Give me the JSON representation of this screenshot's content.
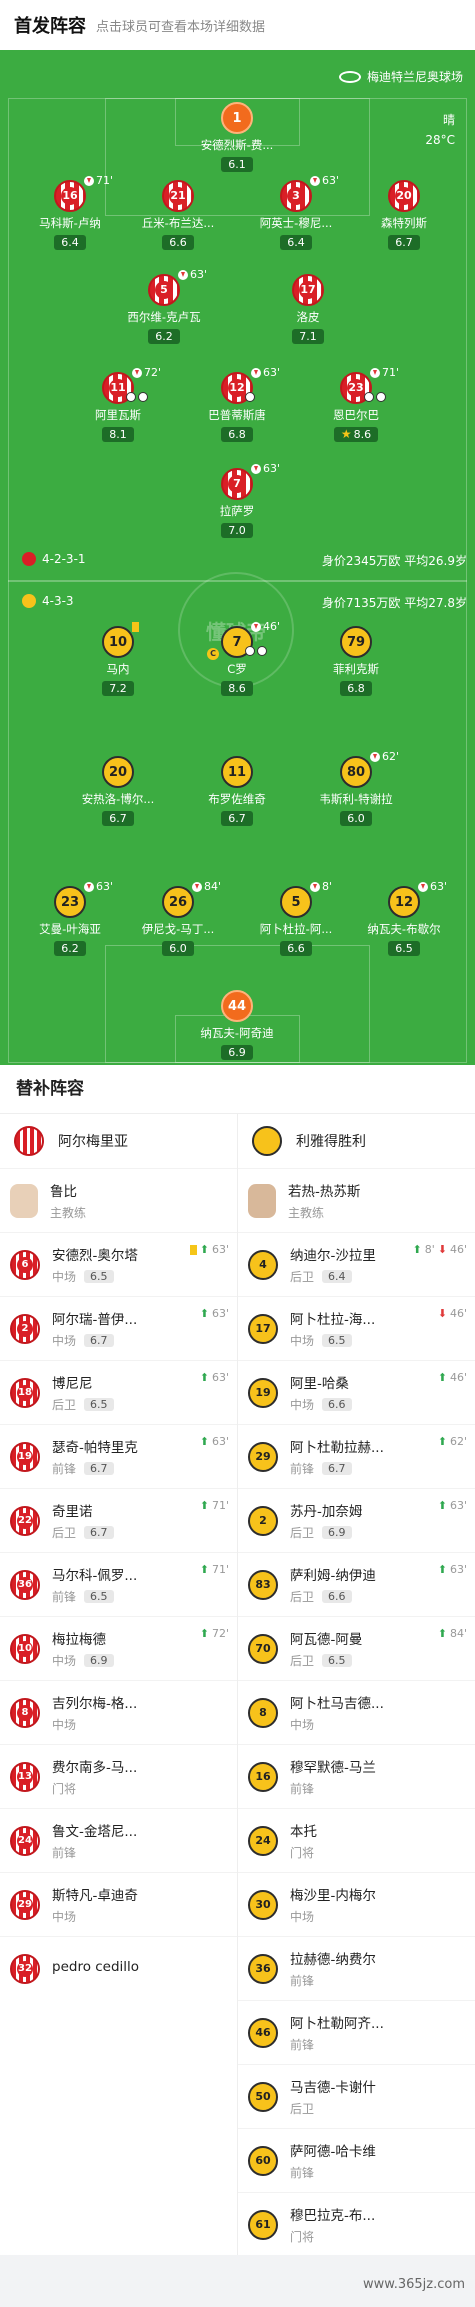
{
  "header": {
    "title": "首发阵容",
    "subtitle": "点击球员可查看本场详细数据"
  },
  "venue": "梅迪特兰尼奥球场",
  "weather": {
    "condition": "晴",
    "temp": "28°C"
  },
  "watermark": "懂球帝",
  "home_team": {
    "formation": "4-2-3-1",
    "value": "身价2345万欧",
    "age": "平均26.9岁"
  },
  "away_team": {
    "formation": "4-3-3",
    "value": "身价7135万欧",
    "age": "平均27.8岁"
  },
  "home_players": [
    {
      "num": "1",
      "name": "安德烈斯-费...",
      "rating": "6.1"
    },
    {
      "num": "16",
      "name": "马科斯-卢纳",
      "rating": "6.4",
      "sub": "71'"
    },
    {
      "num": "21",
      "name": "丘米-布兰达...",
      "rating": "6.6"
    },
    {
      "num": "3",
      "name": "阿英士-穆尼...",
      "rating": "6.4",
      "sub": "63'"
    },
    {
      "num": "20",
      "name": "森特列斯",
      "rating": "6.7"
    },
    {
      "num": "5",
      "name": "西尔维-克卢瓦",
      "rating": "6.2",
      "sub": "63'"
    },
    {
      "num": "17",
      "name": "洛皮",
      "rating": "7.1"
    },
    {
      "num": "11",
      "name": "阿里瓦斯",
      "rating": "8.1",
      "sub": "72'"
    },
    {
      "num": "12",
      "name": "巴普蒂斯唐",
      "rating": "6.8",
      "sub": "63'"
    },
    {
      "num": "23",
      "name": "恩巴尔巴",
      "rating": "8.6",
      "sub": "71'"
    },
    {
      "num": "7",
      "name": "拉萨罗",
      "rating": "7.0",
      "sub": "63'"
    }
  ],
  "away_players": [
    {
      "num": "10",
      "name": "马内",
      "rating": "7.2"
    },
    {
      "num": "7",
      "name": "C罗",
      "rating": "8.6",
      "sub": "46'"
    },
    {
      "num": "79",
      "name": "菲利克斯",
      "rating": "6.8"
    },
    {
      "num": "20",
      "name": "安热洛-博尔...",
      "rating": "6.7"
    },
    {
      "num": "11",
      "name": "布罗佐维奇",
      "rating": "6.7"
    },
    {
      "num": "80",
      "name": "韦斯利-特谢拉",
      "rating": "6.0",
      "sub": "62'"
    },
    {
      "num": "23",
      "name": "艾曼-叶海亚",
      "rating": "6.2",
      "sub": "63'"
    },
    {
      "num": "26",
      "name": "伊尼戈-马丁...",
      "rating": "6.0",
      "sub": "84'"
    },
    {
      "num": "5",
      "name": "阿卜杜拉-阿...",
      "rating": "6.6",
      "sub": "8'"
    },
    {
      "num": "12",
      "name": "纳瓦夫-布歇尔",
      "rating": "6.5",
      "sub": "63'"
    },
    {
      "num": "44",
      "name": "纳瓦夫-阿奇迪",
      "rating": "6.9"
    }
  ],
  "subs": {
    "title": "替补阵容",
    "home_name": "阿尔梅里亚",
    "away_name": "利雅得胜利",
    "coach_label": "主教练",
    "home_coach": "鲁比",
    "away_coach": "若热-热苏斯",
    "home": [
      {
        "num": "6",
        "name": "安德烈-奥尔塔",
        "pos": "中场",
        "rating": "6.5",
        "sub": "63'",
        "dir": "up",
        "yc": true
      },
      {
        "num": "2",
        "name": "阿尔瑞-普伊...",
        "pos": "中场",
        "rating": "6.7",
        "sub": "63'",
        "dir": "up"
      },
      {
        "num": "18",
        "name": "博尼尼",
        "pos": "后卫",
        "rating": "6.5",
        "sub": "63'",
        "dir": "up"
      },
      {
        "num": "19",
        "name": "瑟奇-帕特里克",
        "pos": "前锋",
        "rating": "6.7",
        "sub": "63'",
        "dir": "up"
      },
      {
        "num": "22",
        "name": "奇里诺",
        "pos": "后卫",
        "rating": "6.7",
        "sub": "71'",
        "dir": "up"
      },
      {
        "num": "36",
        "name": "马尔科-佩罗...",
        "pos": "前锋",
        "rating": "6.5",
        "sub": "71'",
        "dir": "up"
      },
      {
        "num": "10",
        "name": "梅拉梅德",
        "pos": "中场",
        "rating": "6.9",
        "sub": "72'",
        "dir": "up"
      },
      {
        "num": "8",
        "name": "吉列尔梅-格...",
        "pos": "中场"
      },
      {
        "num": "13",
        "name": "费尔南多-马...",
        "pos": "门将"
      },
      {
        "num": "24",
        "name": "鲁文-金塔尼...",
        "pos": "前锋"
      },
      {
        "num": "29",
        "name": "斯特凡-卓迪奇",
        "pos": "中场"
      },
      {
        "num": "32",
        "name": "pedro cedillo",
        "pos": ""
      }
    ],
    "away": [
      {
        "num": "4",
        "name": "纳迪尔-沙拉里",
        "pos": "后卫",
        "rating": "6.4",
        "sub": "8'",
        "sub2": "46'",
        "dir": "both"
      },
      {
        "num": "17",
        "name": "阿卜杜拉-海...",
        "pos": "中场",
        "rating": "6.5",
        "sub": "46'",
        "dir": "dn"
      },
      {
        "num": "19",
        "name": "阿里-哈桑",
        "pos": "中场",
        "rating": "6.6",
        "sub": "46'",
        "dir": "up"
      },
      {
        "num": "29",
        "name": "阿卜杜勒拉赫...",
        "pos": "前锋",
        "rating": "6.7",
        "sub": "62'",
        "dir": "up"
      },
      {
        "num": "2",
        "name": "苏丹-加奈姆",
        "pos": "后卫",
        "rating": "6.9",
        "sub": "63'",
        "dir": "up"
      },
      {
        "num": "83",
        "name": "萨利姆-纳伊迪",
        "pos": "后卫",
        "rating": "6.6",
        "sub": "63'",
        "dir": "up"
      },
      {
        "num": "70",
        "name": "阿瓦德-阿曼",
        "pos": "后卫",
        "rating": "6.5",
        "sub": "84'",
        "dir": "up"
      },
      {
        "num": "8",
        "name": "阿卜杜马吉德...",
        "pos": "中场"
      },
      {
        "num": "16",
        "name": "穆罕默德-马兰",
        "pos": "前锋"
      },
      {
        "num": "24",
        "name": "本托",
        "pos": "门将"
      },
      {
        "num": "30",
        "name": "梅沙里-内梅尔",
        "pos": "中场"
      },
      {
        "num": "36",
        "name": "拉赫德-纳费尔",
        "pos": "前锋"
      },
      {
        "num": "46",
        "name": "阿卜杜勒阿齐...",
        "pos": "前锋"
      },
      {
        "num": "50",
        "name": "马吉德-卡谢什",
        "pos": "后卫"
      },
      {
        "num": "60",
        "name": "萨阿德-哈卡维",
        "pos": "前锋"
      },
      {
        "num": "61",
        "name": "穆巴拉克-布...",
        "pos": "门将"
      }
    ]
  },
  "footer": {
    "watermark": "www.365jz.com"
  },
  "colors": {
    "pitch": "#3cac41",
    "almeria_red": "#d91f26",
    "alnassr_yellow": "#f7c21b",
    "gk_orange": "#f26b1d"
  }
}
